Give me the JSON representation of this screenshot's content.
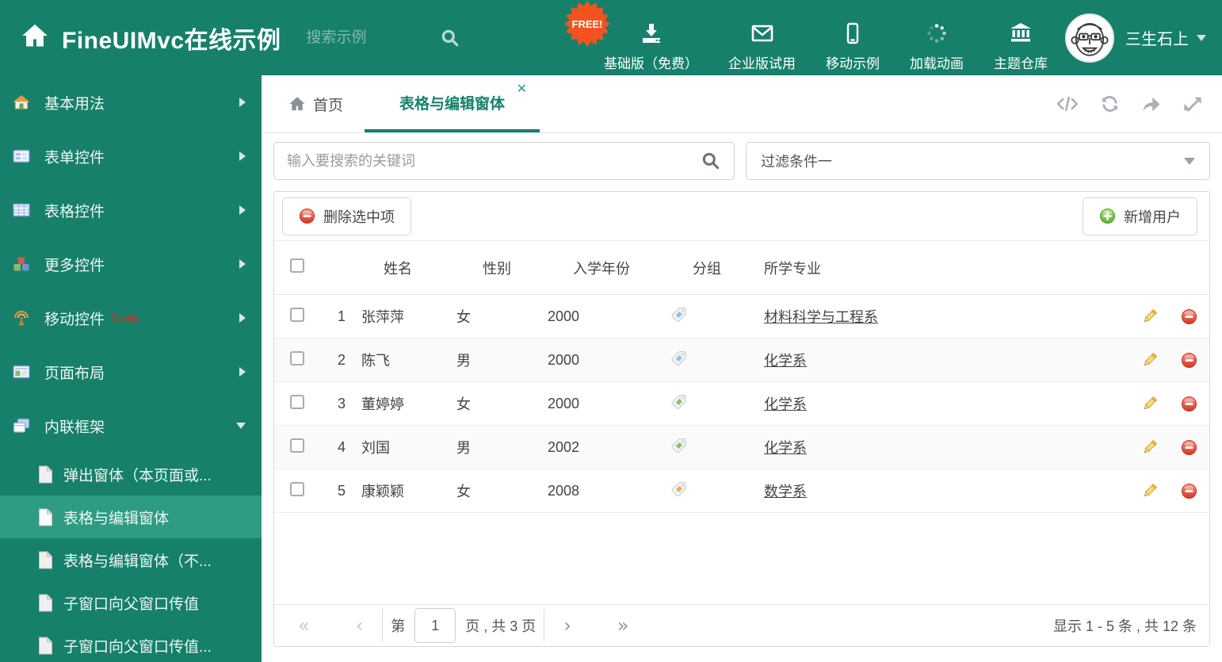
{
  "colors": {
    "accent": "#16806b",
    "sidebar_selected": "#2e9b85",
    "free_badge": "#f4531e",
    "corp_red": "#ff1a1a"
  },
  "header": {
    "title": "FineUIMvc在线示例",
    "search_placeholder": "搜索示例",
    "free_badge": "FREE!",
    "nav": [
      {
        "label": "基础版（免费）",
        "icon": "download-icon"
      },
      {
        "label": "企业版试用",
        "icon": "envelope-icon"
      },
      {
        "label": "移动示例",
        "icon": "mobile-icon"
      },
      {
        "label": "加载动画",
        "icon": "spinner-icon"
      },
      {
        "label": "主题仓库",
        "icon": "bank-icon"
      }
    ],
    "user_name": "三生石上"
  },
  "sidebar": {
    "items": [
      {
        "label": "基本用法",
        "icon": "home-icon"
      },
      {
        "label": "表单控件",
        "icon": "form-icon"
      },
      {
        "label": "表格控件",
        "icon": "table-icon"
      },
      {
        "label": "更多控件",
        "icon": "cubes-icon"
      },
      {
        "label": "移动控件",
        "icon": "antenna-icon",
        "badge": "Corp."
      },
      {
        "label": "页面布局",
        "icon": "layout-icon"
      },
      {
        "label": "内联框架",
        "icon": "frames-icon",
        "expanded": true,
        "children": [
          {
            "label": "弹出窗体（本页面或..."
          },
          {
            "label": "表格与编辑窗体",
            "selected": true
          },
          {
            "label": "表格与编辑窗体（不..."
          },
          {
            "label": "子窗口向父窗口传值"
          },
          {
            "label": "子窗口向父窗口传值..."
          }
        ]
      }
    ]
  },
  "tabbar": {
    "home_tab": "首页",
    "active_tab": "表格与编辑窗体",
    "close_glyph": "✕"
  },
  "filters": {
    "search_placeholder": "输入要搜索的关键词",
    "filter_value": "过滤条件一"
  },
  "grid": {
    "delete_button": "删除选中项",
    "add_button": "新增用户",
    "columns": {
      "name": "姓名",
      "gender": "性别",
      "year": "入学年份",
      "group": "分组",
      "major": "所学专业"
    },
    "rows": [
      {
        "num": "1",
        "name": "张萍萍",
        "gender": "女",
        "year": "2000",
        "tag_color": "#85c6f2",
        "major": "材料科学与工程系"
      },
      {
        "num": "2",
        "name": "陈飞",
        "gender": "男",
        "year": "2000",
        "tag_color": "#85c6f2",
        "major": "化学系"
      },
      {
        "num": "3",
        "name": "董婷婷",
        "gender": "女",
        "year": "2000",
        "tag_color": "#8dc063",
        "major": "化学系"
      },
      {
        "num": "4",
        "name": "刘国",
        "gender": "男",
        "year": "2002",
        "tag_color": "#8dc063",
        "major": "化学系"
      },
      {
        "num": "5",
        "name": "康颖颖",
        "gender": "女",
        "year": "2008",
        "tag_color": "#f0a95f",
        "major": "数学系"
      }
    ]
  },
  "pagination": {
    "first_glyph": "«",
    "prev_glyph": "‹",
    "page_prefix": "第",
    "page": "1",
    "page_suffix": "页 , 共 3 页",
    "next_glyph": "›",
    "last_glyph": "»",
    "summary": "显示 1 - 5 条 , 共 12 条"
  }
}
